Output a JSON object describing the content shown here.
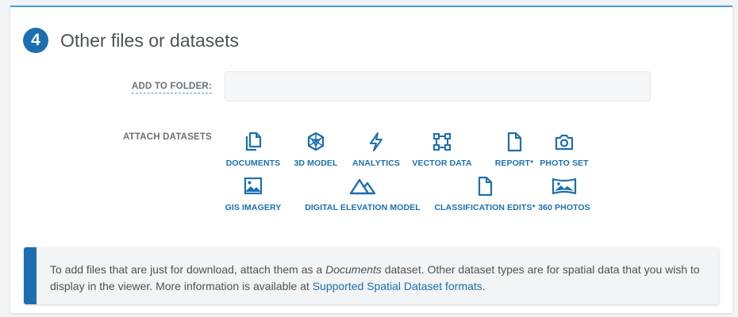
{
  "section": {
    "step": "4",
    "title": "Other files or datasets"
  },
  "folder": {
    "label": "ADD TO FOLDER:",
    "value": ""
  },
  "attach": {
    "label": "ATTACH DATASETS",
    "datasets": [
      {
        "label": "DOCUMENTS",
        "icon": "documents-icon"
      },
      {
        "label": "3D MODEL",
        "icon": "3d-model-icon"
      },
      {
        "label": "ANALYTICS",
        "icon": "analytics-icon"
      },
      {
        "label": "VECTOR DATA",
        "icon": "vector-data-icon"
      },
      {
        "label": "REPORT*",
        "icon": "report-icon"
      },
      {
        "label": "PHOTO SET",
        "icon": "camera-icon"
      },
      {
        "label": "GIS IMAGERY",
        "icon": "image-icon"
      },
      {
        "label": "DIGITAL ELEVATION MODEL",
        "icon": "mountain-icon"
      },
      {
        "label": "CLASSIFICATION EDITS*",
        "icon": "file-icon"
      },
      {
        "label": "360 PHOTOS",
        "icon": "panorama-icon"
      }
    ]
  },
  "info": {
    "text_before": "To add files that are just for download, attach them as a ",
    "text_em": "Documents",
    "text_after": " dataset. Other dataset types are for spatial data that you wish to display in the viewer. More information is available at ",
    "link_text": "Supported Spatial Dataset formats",
    "text_end": "."
  },
  "colors": {
    "accent": "#1b6fb0",
    "card_top_border": "#4a9cd6",
    "text": "#4d5258"
  }
}
